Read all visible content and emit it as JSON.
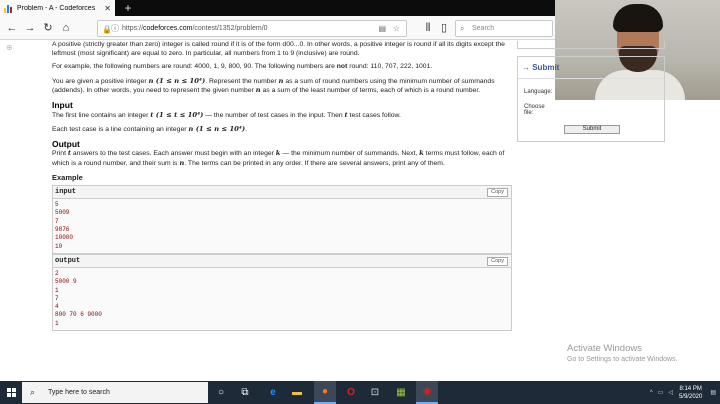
{
  "browser": {
    "tab_title": "Problem - A - Codeforces",
    "url_prefix": "https://",
    "url_domain": "codeforces.com",
    "url_path": "/contest/1352/problem/0",
    "search_placeholder": "Search"
  },
  "problem": {
    "p1": "A positive (strictly greater than zero) integer is called round if it is of the form d00...0. In other words, a positive integer is round if all its digits except the leftmost (most significant) are equal to zero. In particular, all numbers from 1 to 9 (inclusive) are round.",
    "p2a": "For example, the following numbers are round: 4000, 1, 9, 800, 90. The following numbers are ",
    "p2b": "not",
    "p2c": " round: 110, 707, 222, 1001.",
    "p3a": "You are given a positive integer ",
    "p3m1": "n (1 ≤ n ≤ 10⁴)",
    "p3b": ". Represent the number ",
    "p3m2": "n",
    "p3c": " as a sum of round numbers using the minimum number of summands (addends). In other words, you need to represent the given number ",
    "p3m3": "n",
    "p3d": " as a sum of the least number of terms, each of which is a round number.",
    "input_heading": "Input",
    "in1a": "The first line contains an integer ",
    "in1m": "t (1 ≤ t ≤ 10⁴)",
    "in1b": " — the number of test cases in the input. Then ",
    "in1m2": "t",
    "in1c": " test cases follow.",
    "in2a": "Each test case is a line containing an integer ",
    "in2m": "n (1 ≤ n ≤ 10⁴)",
    "in2b": ".",
    "output_heading": "Output",
    "out1a": "Print ",
    "out1m": "t",
    "out1b": " answers to the test cases. Each answer must begin with an integer ",
    "out1m2": "k",
    "out1c": " — the minimum number of summands. Next, ",
    "out1m3": "k",
    "out1d": " terms must follow, each of which is a round number, and their sum is ",
    "out1m4": "n",
    "out1e": ". The terms can be printed in any order. If there are several answers, print any of them.",
    "example_heading": "Example",
    "input_label": "input",
    "output_label": "output",
    "copy_label": "Copy",
    "input_lines": [
      "5",
      "5009",
      "7",
      "9876",
      "10000",
      "10"
    ],
    "output_lines": [
      "2",
      "5000 9",
      "1",
      "7",
      "4",
      "800 70 6 9000",
      "1"
    ]
  },
  "sidebar": {
    "submit_title": "→ Submit",
    "language_label": "Language:",
    "choose_file_label": "Choose file:",
    "submit_button": "Submit"
  },
  "watermark": {
    "line1": "Activate Windows",
    "line2": "Go to Settings to activate Windows."
  },
  "taskbar": {
    "search_text": "Type here to search",
    "time": "8:14 PM",
    "date": "5/9/2020"
  }
}
